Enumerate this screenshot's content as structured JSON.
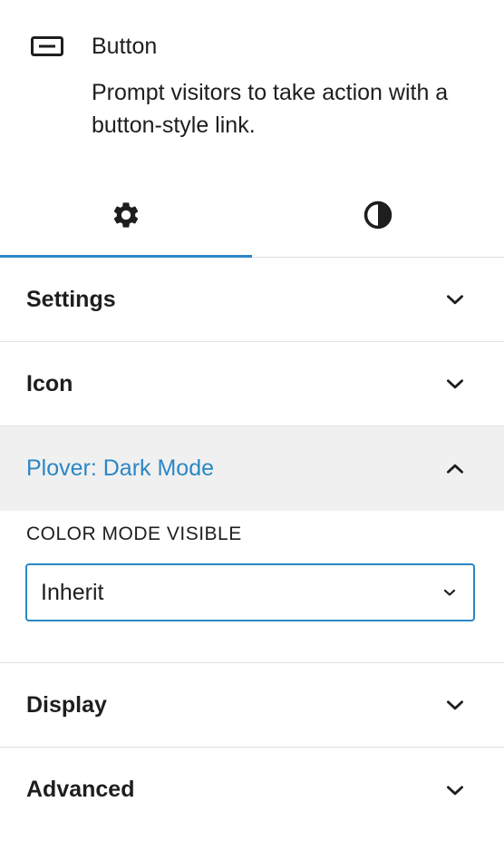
{
  "block": {
    "icon": "button-block-icon",
    "title": "Button",
    "description": "Prompt visitors to take action with a button-style link."
  },
  "tabs": [
    {
      "icon": "gear-icon",
      "active": true
    },
    {
      "icon": "contrast-icon",
      "active": false
    }
  ],
  "panels": {
    "settings": {
      "label": "Settings"
    },
    "icon": {
      "label": "Icon"
    },
    "dark_mode": {
      "label": "Plover: Dark Mode",
      "field_label": "COLOR MODE VISIBLE",
      "select_value": "Inherit"
    },
    "display": {
      "label": "Display"
    },
    "advanced": {
      "label": "Advanced"
    }
  },
  "colors": {
    "accent": "#2b87c5",
    "text": "#1e1e1e",
    "divider": "#e0e0e0",
    "open_panel_bg": "#f0f0f0"
  }
}
